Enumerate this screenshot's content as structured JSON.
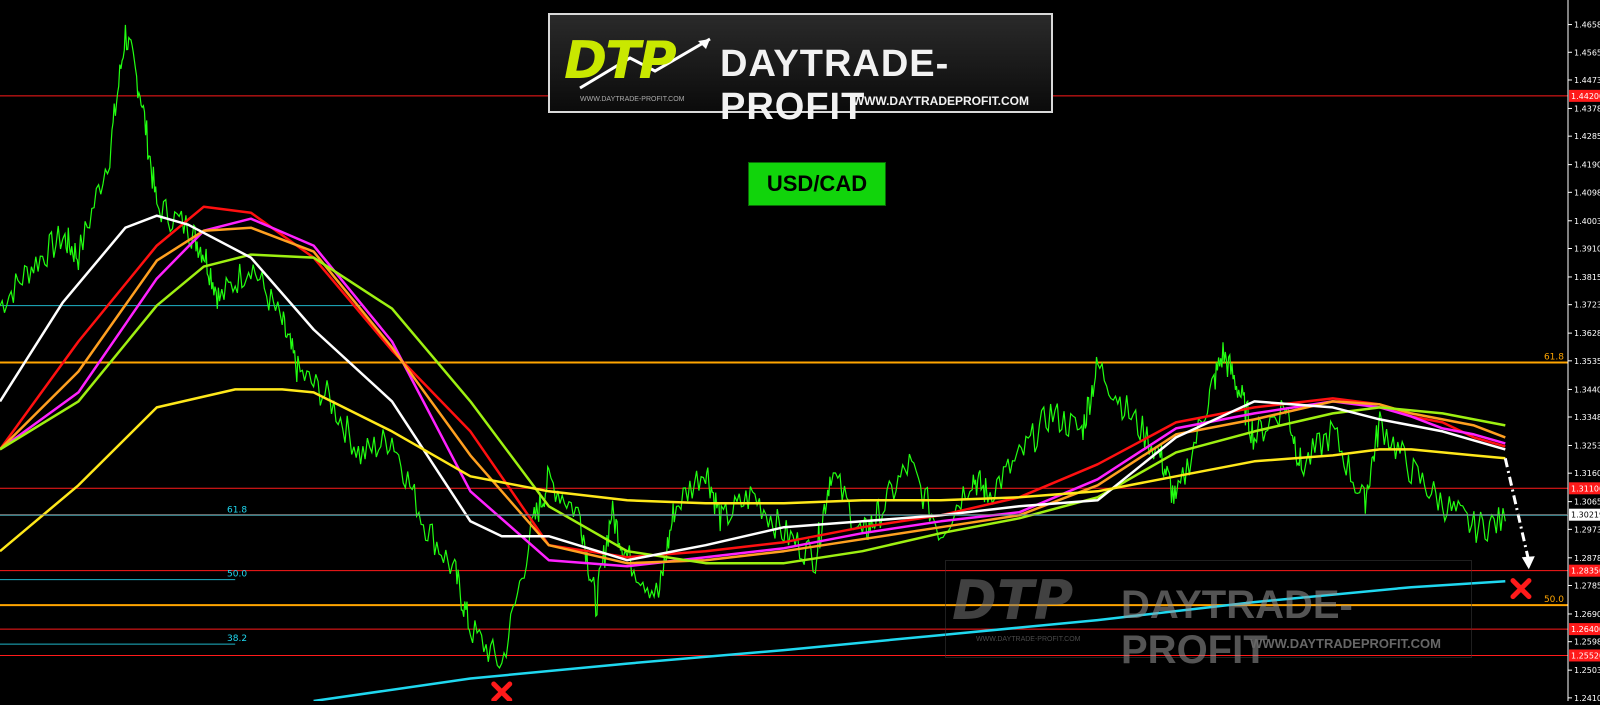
{
  "chart_data": {
    "type": "line",
    "symbol": "USD/CAD",
    "x_index_range": [
      0,
      100
    ],
    "ylim": [
      1.24,
      1.474
    ],
    "y_ticks": [
      "1.46580",
      "1.45655",
      "1.44730",
      "1.43780",
      "1.42855",
      "1.41905",
      "1.40980",
      "1.40030",
      "1.39105",
      "1.38155",
      "1.37230",
      "1.36280",
      "1.35355",
      "1.34400",
      "1.33480",
      "1.32530",
      "1.31605",
      "1.30655",
      "1.29730",
      "1.28780",
      "1.27855",
      "1.26905",
      "1.25980",
      "1.25030",
      "1.24105"
    ],
    "y_tick_values": [
      1.4658,
      1.45655,
      1.4473,
      1.4378,
      1.42855,
      1.41905,
      1.4098,
      1.4003,
      1.39105,
      1.38155,
      1.3723,
      1.3628,
      1.35355,
      1.344,
      1.3348,
      1.3253,
      1.31605,
      1.30655,
      1.2973,
      1.2878,
      1.27855,
      1.26905,
      1.2598,
      1.2503,
      1.24105
    ],
    "current_price": "1.30219",
    "current_price_value": 1.30219,
    "horizontal_levels": [
      {
        "value": 1.442,
        "color": "#ff1a1a",
        "label": "1.44200"
      },
      {
        "value": 1.353,
        "color": "#ffa500",
        "label": "61.8"
      },
      {
        "value": 1.311,
        "color": "#ff1a1a",
        "label": "1.31100"
      },
      {
        "value": 1.2835,
        "color": "#ff1a1a",
        "label": "1.28350"
      },
      {
        "value": 1.272,
        "color": "#ffa500",
        "label": "50.0"
      },
      {
        "value": 1.264,
        "color": "#ff1a1a",
        "label": "1.26400"
      },
      {
        "value": 1.2552,
        "color": "#ff1a1a",
        "label": "1.25520"
      }
    ],
    "fib_inner_levels": [
      {
        "value": 1.372,
        "label": "",
        "x": 0,
        "x2": 23
      },
      {
        "value": 1.302,
        "label": "61.8",
        "x": 0,
        "x2": 100
      },
      {
        "value": 1.2805,
        "label": "50.0",
        "x": 0,
        "x2": 15
      },
      {
        "value": 1.259,
        "label": "38.2",
        "x": 0,
        "x2": 15
      }
    ],
    "price": {
      "x": [
        0,
        2,
        4,
        5,
        7,
        8,
        9,
        10,
        12,
        13,
        14,
        16,
        18,
        19,
        21,
        23,
        25,
        27,
        29,
        30,
        32,
        34,
        35,
        37,
        38,
        39,
        40,
        42,
        43,
        45,
        46,
        48,
        50,
        52,
        53,
        55,
        56,
        58,
        60,
        62,
        63,
        65,
        67,
        69,
        70,
        72,
        74,
        75,
        77,
        78,
        79,
        80,
        82,
        83,
        85,
        87,
        88,
        90,
        92,
        94,
        96
      ],
      "y": [
        1.372,
        1.385,
        1.395,
        1.3885,
        1.423,
        1.463,
        1.442,
        1.405,
        1.398,
        1.39,
        1.374,
        1.386,
        1.366,
        1.35,
        1.341,
        1.322,
        1.328,
        1.3,
        1.283,
        1.264,
        1.252,
        1.299,
        1.314,
        1.302,
        1.272,
        1.303,
        1.288,
        1.275,
        1.304,
        1.318,
        1.3,
        1.309,
        1.296,
        1.288,
        1.317,
        1.295,
        1.302,
        1.319,
        1.296,
        1.315,
        1.309,
        1.321,
        1.336,
        1.33,
        1.352,
        1.336,
        1.322,
        1.306,
        1.34,
        1.356,
        1.344,
        1.328,
        1.339,
        1.318,
        1.33,
        1.306,
        1.333,
        1.317,
        1.306,
        1.298,
        1.3
      ]
    },
    "series": [
      {
        "color": "#ff1010",
        "x": [
          0,
          5,
          10,
          13,
          16,
          20,
          25,
          30,
          35,
          40,
          45,
          50,
          55,
          60,
          65,
          70,
          75,
          80,
          85,
          88,
          90,
          92,
          94,
          96
        ],
        "y": [
          1.324,
          1.36,
          1.392,
          1.405,
          1.403,
          1.388,
          1.357,
          1.33,
          1.292,
          1.288,
          1.29,
          1.293,
          1.298,
          1.302,
          1.308,
          1.319,
          1.333,
          1.338,
          1.341,
          1.339,
          1.335,
          1.333,
          1.328,
          1.325
        ]
      },
      {
        "color": "#ff22ff",
        "x": [
          0,
          5,
          10,
          13,
          16,
          20,
          25,
          30,
          35,
          40,
          45,
          50,
          55,
          60,
          65,
          70,
          75,
          80,
          85,
          88,
          90,
          92,
          94,
          96
        ],
        "y": [
          1.324,
          1.343,
          1.381,
          1.397,
          1.401,
          1.392,
          1.36,
          1.31,
          1.287,
          1.285,
          1.288,
          1.291,
          1.296,
          1.3,
          1.303,
          1.314,
          1.331,
          1.336,
          1.34,
          1.338,
          1.335,
          1.331,
          1.329,
          1.326
        ]
      },
      {
        "color": "#ffa020",
        "x": [
          0,
          5,
          10,
          13,
          16,
          20,
          25,
          30,
          35,
          40,
          45,
          50,
          55,
          60,
          65,
          70,
          75,
          80,
          85,
          88,
          90,
          92,
          94,
          96
        ],
        "y": [
          1.324,
          1.35,
          1.387,
          1.397,
          1.398,
          1.39,
          1.358,
          1.322,
          1.292,
          1.286,
          1.287,
          1.29,
          1.294,
          1.298,
          1.302,
          1.312,
          1.329,
          1.334,
          1.34,
          1.339,
          1.336,
          1.334,
          1.332,
          1.328
        ]
      },
      {
        "color": "#9ef011",
        "x": [
          0,
          5,
          10,
          13,
          16,
          20,
          25,
          30,
          35,
          40,
          45,
          50,
          55,
          60,
          65,
          70,
          75,
          80,
          85,
          88,
          90,
          92,
          94,
          96
        ],
        "y": [
          1.324,
          1.34,
          1.372,
          1.385,
          1.389,
          1.388,
          1.371,
          1.34,
          1.305,
          1.29,
          1.286,
          1.286,
          1.29,
          1.296,
          1.301,
          1.308,
          1.323,
          1.33,
          1.336,
          1.338,
          1.337,
          1.336,
          1.334,
          1.332
        ]
      },
      {
        "color": "#ffffff",
        "x": [
          0,
          4,
          8,
          10,
          12,
          16,
          20,
          25,
          30,
          32,
          35,
          40,
          45,
          50,
          55,
          60,
          65,
          70,
          75,
          80,
          85,
          88,
          90,
          92,
          94,
          96
        ],
        "y": [
          1.34,
          1.373,
          1.398,
          1.402,
          1.399,
          1.388,
          1.364,
          1.34,
          1.3,
          1.295,
          1.295,
          1.287,
          1.292,
          1.298,
          1.3,
          1.302,
          1.305,
          1.307,
          1.328,
          1.34,
          1.338,
          1.334,
          1.332,
          1.33,
          1.327,
          1.324
        ]
      },
      {
        "color": "#ffe81a",
        "x": [
          0,
          5,
          10,
          15,
          18,
          20,
          25,
          30,
          35,
          40,
          45,
          50,
          55,
          60,
          65,
          70,
          75,
          80,
          85,
          88,
          90,
          92,
          94,
          96
        ],
        "y": [
          1.29,
          1.312,
          1.338,
          1.344,
          1.344,
          1.343,
          1.33,
          1.315,
          1.31,
          1.307,
          1.306,
          1.306,
          1.307,
          1.307,
          1.308,
          1.31,
          1.315,
          1.32,
          1.322,
          1.324,
          1.324,
          1.323,
          1.322,
          1.321
        ]
      },
      {
        "color": "#1fd8f0",
        "x": [
          20,
          30,
          40,
          50,
          60,
          70,
          80,
          90,
          96
        ],
        "y": [
          1.24,
          1.2475,
          1.2525,
          1.257,
          1.262,
          1.267,
          1.273,
          1.278,
          1.28
        ]
      }
    ],
    "projection": {
      "from": [
        96,
        1.321
      ],
      "to": [
        97.5,
        1.284
      ],
      "color": "#ffffff"
    },
    "markers": [
      {
        "type": "x",
        "color": "#ff1a1a",
        "x": 32,
        "y": 1.243
      },
      {
        "type": "x",
        "color": "#ff1a1a",
        "x": 97,
        "y": 1.2775
      }
    ],
    "grid": false
  },
  "logo": {
    "dtp": "DTP",
    "name": "DAYTRADE-PROFIT",
    "url": "WWW.DAYTRADEPROFIT.COM",
    "url_small": "WWW.DAYTRADE-PROFIT.COM"
  },
  "pair_badge": "USD/CAD",
  "colors": {
    "background": "#000000",
    "price": "#22ff11",
    "badge": "#11d40b"
  }
}
